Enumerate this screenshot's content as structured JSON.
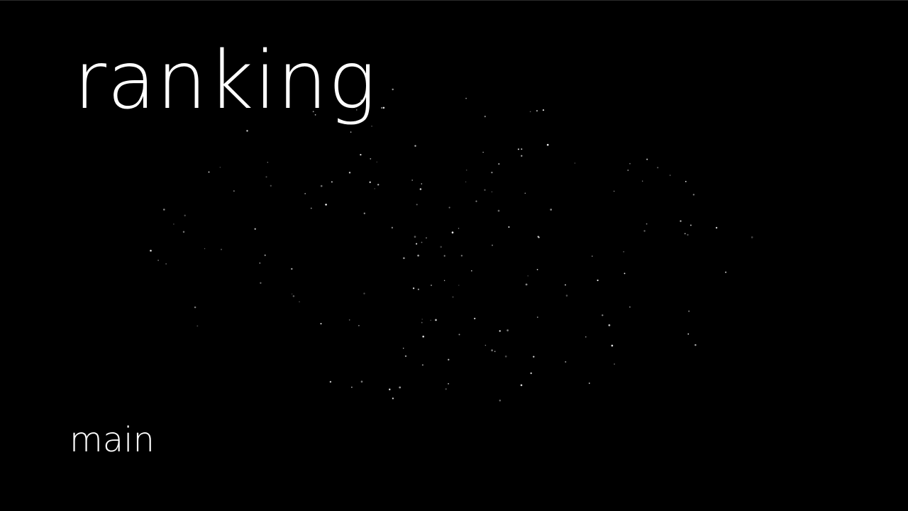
{
  "screen": {
    "title": "ranking",
    "menu_main_label": "main"
  },
  "colors": {
    "background": "#000000",
    "text": "#ffffff",
    "star": "#ffffff"
  },
  "icons": {
    "background": "starfield"
  }
}
